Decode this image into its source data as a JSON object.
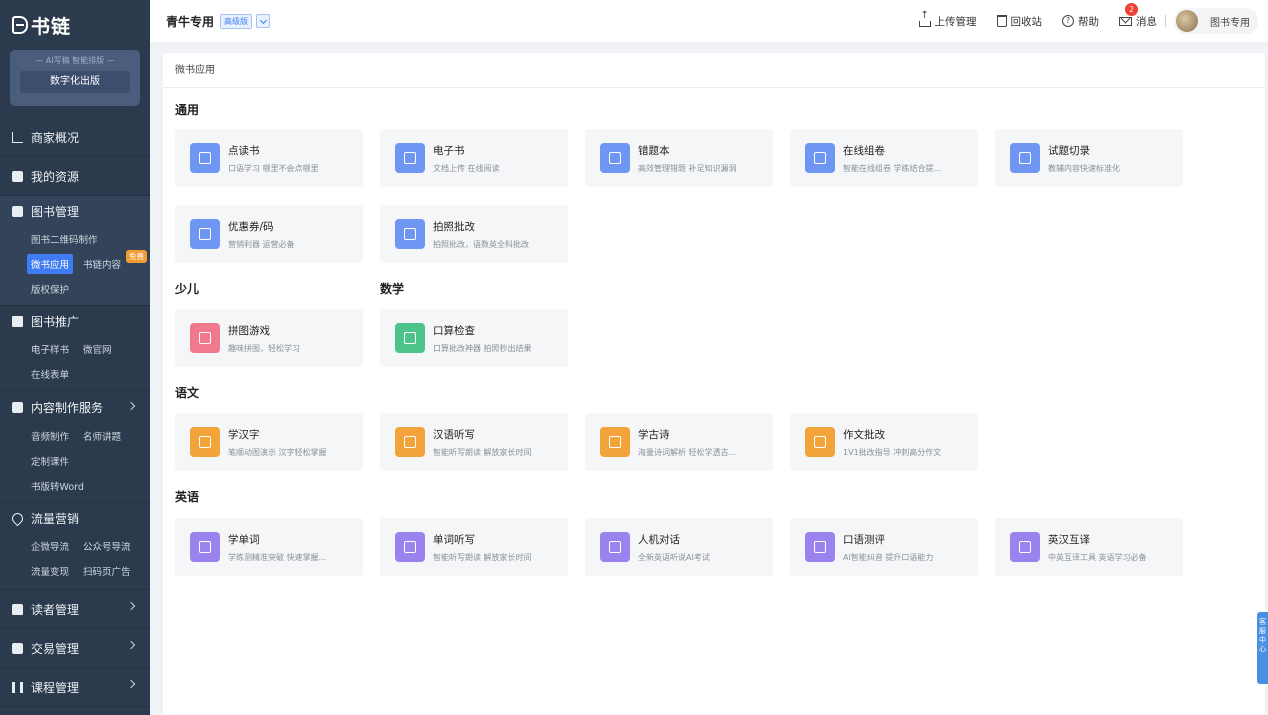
{
  "sidebar": {
    "logo": "书链",
    "promo_tagline": "— AI写稿 智能排版 —",
    "promo_button": "数字化出版",
    "groups": [
      {
        "label": "商家概况",
        "icon": "chart-icon"
      },
      {
        "label": "我的资源",
        "icon": "resource-icon"
      },
      {
        "label": "图书管理",
        "icon": "book-icon",
        "subs": [
          [
            "图书二维码制作"
          ],
          [
            "微书应用",
            "书链内容"
          ],
          [
            "版权保护"
          ]
        ]
      },
      {
        "label": "图书推广",
        "icon": "promote-icon",
        "subs": [
          [
            "电子样书",
            "微官网"
          ],
          [
            "在线表单"
          ]
        ]
      },
      {
        "label": "内容制作服务",
        "icon": "content-icon",
        "subs": [
          [
            "音频制作",
            "名师讲题"
          ],
          [
            "定制课件"
          ],
          [
            "书版转Word"
          ]
        ]
      },
      {
        "label": "流量营销",
        "icon": "traffic-icon",
        "subs": [
          [
            "企微导流",
            "公众号导流"
          ],
          [
            "流量变现",
            "扫码页广告"
          ]
        ]
      },
      {
        "label": "读者管理",
        "icon": "reader-icon"
      },
      {
        "label": "交易管理",
        "icon": "trade-icon"
      },
      {
        "label": "课程管理",
        "icon": "course-icon"
      }
    ],
    "free_badge": "免费"
  },
  "header": {
    "org": "青牛专用",
    "level": "高级版",
    "actions": {
      "upload": "上传管理",
      "recycle": "回收站",
      "help": "帮助",
      "messages": "消息",
      "message_count": "2"
    },
    "user": "图书专用"
  },
  "main": {
    "title": "微书应用",
    "sections": {
      "general": "通用",
      "kids": "少儿",
      "math": "数学",
      "chinese": "语文",
      "english": "英语"
    },
    "cards": {
      "c1": {
        "name": "点读书",
        "desc": "口语学习 哪里不会点哪里"
      },
      "c2": {
        "name": "电子书",
        "desc": "文档上传 在线阅读"
      },
      "c3": {
        "name": "错题本",
        "desc": "高效管理错题 补足知识漏洞"
      },
      "c4": {
        "name": "在线组卷",
        "desc": "智能在线组卷 学练结合提..."
      },
      "c5": {
        "name": "试题切录",
        "desc": "教辅内容快速标准化"
      },
      "c6": {
        "name": "优惠券/码",
        "desc": "营销利器 运营必备"
      },
      "c7": {
        "name": "拍照批改",
        "desc": "拍照批改，语数英全科批改"
      },
      "c8": {
        "name": "拼图游戏",
        "desc": "趣味拼图，轻松学习"
      },
      "c9": {
        "name": "口算检查",
        "desc": "口算批改神器 拍照秒出结果"
      },
      "c10": {
        "name": "学汉字",
        "desc": "笔顺动图演示 汉字轻松掌握"
      },
      "c11": {
        "name": "汉语听写",
        "desc": "智能听写朗读 解放家长时间"
      },
      "c12": {
        "name": "学古诗",
        "desc": "海量诗词解析 轻松学透古..."
      },
      "c13": {
        "name": "作文批改",
        "desc": "1V1批改指导 冲刺高分作文"
      },
      "c14": {
        "name": "学单词",
        "desc": "学练测精准突破 快速掌握..."
      },
      "c15": {
        "name": "单词听写",
        "desc": "智能听写朗读 解放家长时间"
      },
      "c16": {
        "name": "人机对话",
        "desc": "全新英语听说AI考试"
      },
      "c17": {
        "name": "口语测评",
        "desc": "AI智能纠音 提升口语能力"
      },
      "c18": {
        "name": "英汉互译",
        "desc": "中英互译工具 英语学习必备"
      }
    },
    "colors": {
      "blue": "#6f96f2",
      "pink": "#f0798d",
      "green": "#4cc38a",
      "orange": "#f2a33a",
      "purple": "#9a82ef"
    }
  },
  "service_tab": "客服中心"
}
